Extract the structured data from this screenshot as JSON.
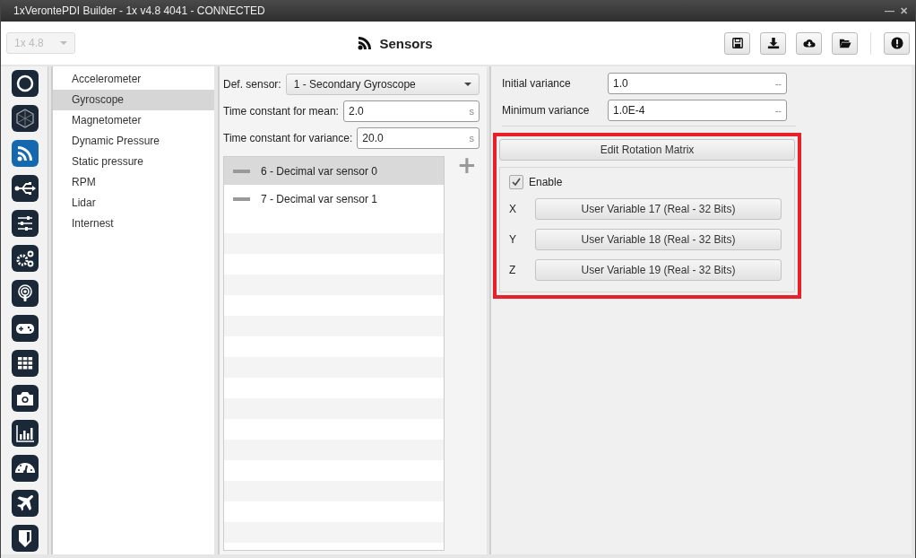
{
  "window": {
    "title": "1xVerontePDI Builder - 1x v4.8 4041 - CONNECTED",
    "controls": [
      "—",
      "✕"
    ]
  },
  "toolbar": {
    "version_select": {
      "value": "1x 4.8",
      "disabled": true
    },
    "title": "Sensors"
  },
  "rail": [
    {
      "selected": false
    },
    {
      "selected": false
    },
    {
      "selected": true
    },
    {
      "selected": false
    },
    {
      "selected": false
    },
    {
      "selected": false
    },
    {
      "selected": false
    },
    {
      "selected": false
    },
    {
      "selected": false
    },
    {
      "selected": false
    },
    {
      "selected": false
    },
    {
      "selected": false
    },
    {
      "selected": false
    },
    {
      "selected": false
    }
  ],
  "sidebar": {
    "items": [
      {
        "label": "Accelerometer",
        "selected": false
      },
      {
        "label": "Gyroscope",
        "selected": true
      },
      {
        "label": "Magnetometer",
        "selected": false
      },
      {
        "label": "Dynamic Pressure",
        "selected": false
      },
      {
        "label": "Static pressure",
        "selected": false
      },
      {
        "label": "RPM",
        "selected": false
      },
      {
        "label": "Lidar",
        "selected": false
      },
      {
        "label": "Internest",
        "selected": false
      }
    ]
  },
  "middle": {
    "def_sensor": {
      "label": "Def. sensor:",
      "value": "1 - Secondary Gyroscope"
    },
    "fields": [
      {
        "label": "Time constant for mean:",
        "value": "2.0",
        "unit": "s"
      },
      {
        "label": "Time constant for variance:",
        "value": "20.0",
        "unit": "s"
      }
    ],
    "sensors": [
      {
        "label": "6 - Decimal var sensor 0",
        "selected": true
      },
      {
        "label": "7 - Decimal var sensor 1",
        "selected": false
      }
    ],
    "add_button": "+"
  },
  "right": {
    "fields": [
      {
        "label": "Initial variance",
        "value": "1.0",
        "unit": "--"
      },
      {
        "label": "Minimum variance",
        "value": "1.0E-4",
        "unit": "--"
      }
    ],
    "rotation": {
      "highlighted": true,
      "button": "Edit Rotation Matrix",
      "enable": {
        "label": "Enable",
        "checked": true
      },
      "axes": [
        {
          "label": "X",
          "value": "User Variable 17 (Real - 32 Bits)"
        },
        {
          "label": "Y",
          "value": "User Variable 18 (Real - 32 Bits)"
        },
        {
          "label": "Z",
          "value": "User Variable 19 (Real - 32 Bits)"
        }
      ]
    }
  }
}
